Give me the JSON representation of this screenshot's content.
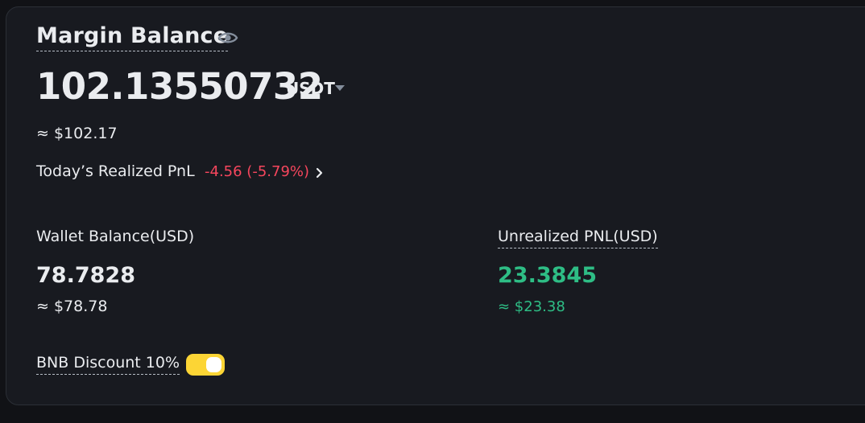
{
  "header": {
    "title": "Margin Balance",
    "visibility_icon": "eye-icon"
  },
  "balance": {
    "value": "102.13550732",
    "currency": "USDT",
    "currency_dropdown_icon": "caret-down-icon",
    "approx": "≈ $102.17"
  },
  "realized_pnl": {
    "label": "Today’s Realized PnL",
    "value": "-4.56 (-5.79%)",
    "arrow_icon": "chevron-right-icon"
  },
  "wallet": {
    "label": "Wallet Balance(USD)",
    "value": "78.7828",
    "approx": "≈ $78.78"
  },
  "unrealized_pnl": {
    "label": "Unrealized PNL(USD)",
    "value": "23.3845",
    "approx": "≈ $23.38"
  },
  "bnb_discount": {
    "label": "BNB Discount 10%",
    "enabled": true
  },
  "colors": {
    "background": "#181a20",
    "text": "#eaecef",
    "negative": "#f6465d",
    "positive": "#2ebd85",
    "toggle_on": "#fcd535",
    "muted": "#848e9c"
  }
}
